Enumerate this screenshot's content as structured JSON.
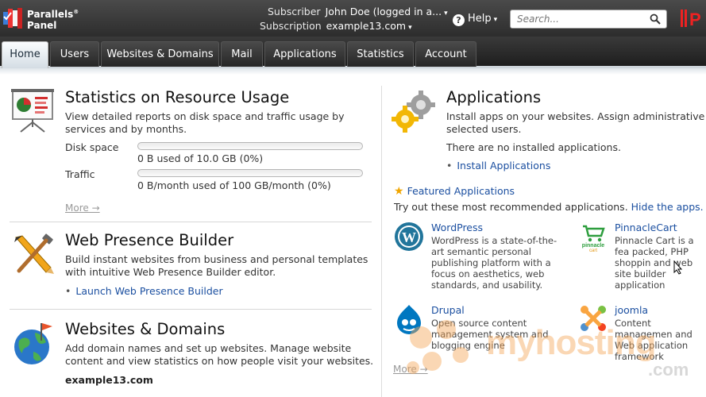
{
  "brand": {
    "name_line1": "Parallels",
    "name_line2": "Panel",
    "reg": "®"
  },
  "account": {
    "subscriber_label": "Subscriber",
    "subscriber_value": "John Doe (logged in a...",
    "subscription_label": "Subscription",
    "subscription_value": "example13.com"
  },
  "help": {
    "label": "Help"
  },
  "search": {
    "placeholder": "Search..."
  },
  "tabs": [
    {
      "label": "Home",
      "active": true
    },
    {
      "label": "Users"
    },
    {
      "label": "Websites & Domains"
    },
    {
      "label": "Mail"
    },
    {
      "label": "Applications"
    },
    {
      "label": "Statistics"
    },
    {
      "label": "Account"
    }
  ],
  "stats": {
    "title": "Statistics on Resource Usage",
    "desc": "View detailed reports on disk space and traffic usage by services and by months.",
    "disk_label": "Disk space",
    "disk_text": "0 B used of 10.0 GB (0%)",
    "disk_fraction": 0,
    "traffic_label": "Traffic",
    "traffic_text": "0 B/month used of 100 GB/month (0%)",
    "traffic_fraction": 0,
    "more": "More →"
  },
  "wpb": {
    "title": "Web Presence Builder",
    "desc": "Build instant websites from business and personal templates with intuitive Web Presence Builder editor.",
    "launch": "Launch Web Presence Builder"
  },
  "websites": {
    "title": "Websites & Domains",
    "desc": "Add domain names and set up websites. Manage website content and view statistics on how people visit your websites.",
    "domain": "example13.com"
  },
  "applications": {
    "title": "Applications",
    "desc_line1": "Install apps on your websites. Assign administrative pri",
    "desc_line2": "selected users.",
    "none_text": "There are no installed applications.",
    "install": "Install Applications",
    "featured_title": "Featured Applications",
    "tryout": "Try out these most recommended applications.",
    "hide": "Hide the apps.",
    "more": "More →",
    "apps": [
      {
        "name": "WordPress",
        "desc": "WordPress is a state-of-the-art semantic personal publishing platform with a focus on aesthetics, web standards, and usability."
      },
      {
        "name": "PinnacleCart",
        "desc": "Pinnacle Cart is a fea packed, PHP shoppin and web site builder application"
      },
      {
        "name": "Drupal",
        "desc": "Open source content management system and blogging engine"
      },
      {
        "name": "joomla",
        "desc": "Content managemen and Web application framework"
      }
    ]
  },
  "watermark": {
    "text": "myhosting",
    "sub": ".com"
  }
}
